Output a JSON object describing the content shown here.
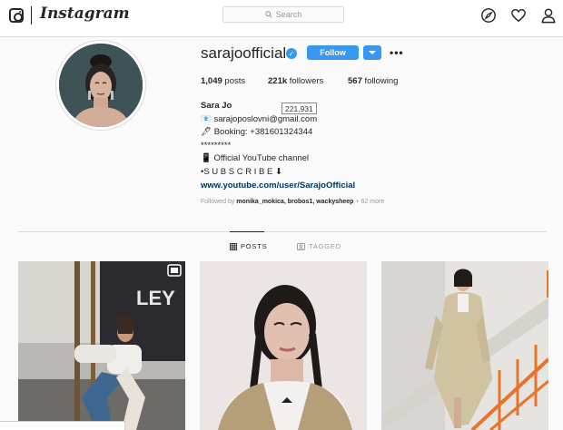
{
  "nav": {
    "logo_text": "Instagram",
    "search_placeholder": "Search"
  },
  "profile": {
    "username": "sarajoofficial",
    "follow_label": "Follow",
    "more_label": "•••",
    "stats": {
      "posts_count": "1,049",
      "posts_label": " posts",
      "followers_count": "221k",
      "followers_label": " followers",
      "following_count": "567",
      "following_label": " following"
    },
    "followers_tooltip": "221,931",
    "bio": {
      "name": "Sara Jo",
      "email_line": "📧 sarajoposlovni@gmail.com",
      "booking_line": "🖋 Booking: +381601324344",
      "separator": "*********",
      "youtube_line": "📱 Official YouTube channel",
      "subscribe_line": "•S U B S C R I B E ⬇",
      "link": "www.youtube.com/user/SarajoOfficial"
    },
    "followed_by": {
      "prefix": "Followed by ",
      "users": "monika_mokica, brobos1, wackysheep",
      "suffix": " + 62 more"
    }
  },
  "tabs": [
    {
      "label": "POSTS",
      "icon": "grid-icon",
      "active": true
    },
    {
      "label": "TAGGED",
      "icon": "tag-icon",
      "active": false
    }
  ],
  "colors": {
    "accent": "#3897f0",
    "link": "#003569",
    "border": "#dbdbdb",
    "background": "#fafafa"
  }
}
